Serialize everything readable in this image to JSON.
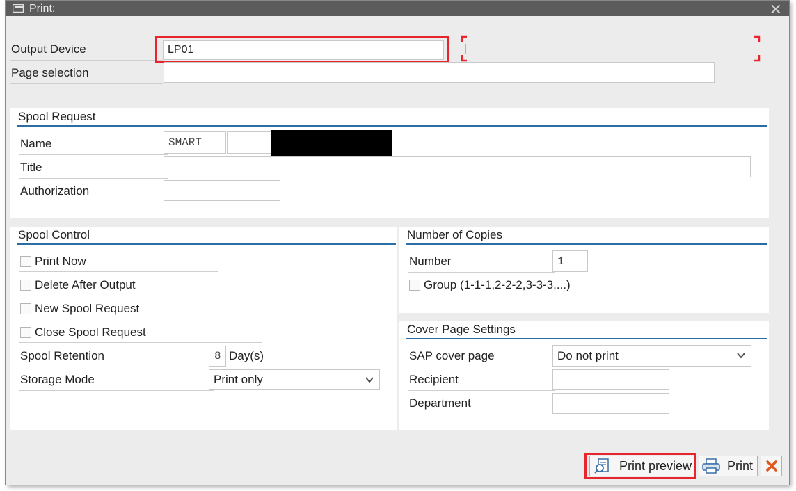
{
  "dialog": {
    "title": "Print:"
  },
  "output": {
    "device_label": "Output Device",
    "device_value": "LP01",
    "page_selection_label": "Page selection",
    "page_selection_value": ""
  },
  "spool_request": {
    "title": "Spool Request",
    "name_label": "Name",
    "name_value": "SMART",
    "name_value2": "",
    "title_label": "Title",
    "title_value": "",
    "authorization_label": "Authorization",
    "authorization_value": ""
  },
  "spool_control": {
    "title": "Spool Control",
    "print_now": "Print Now",
    "delete_after_output": "Delete After Output",
    "new_spool_request": "New Spool Request",
    "close_spool_request": "Close Spool Request",
    "retention_label": "Spool Retention",
    "retention_value": "8",
    "retention_unit": "Day(s)",
    "storage_mode_label": "Storage Mode",
    "storage_mode_value": "Print only"
  },
  "copies": {
    "title": "Number of Copies",
    "number_label": "Number",
    "number_value": "1",
    "group_label": "Group (1-1-1,2-2-2,3-3-3,...)"
  },
  "cover_page": {
    "title": "Cover Page Settings",
    "sap_cover_label": "SAP cover page",
    "sap_cover_value": "Do not print",
    "recipient_label": "Recipient",
    "recipient_value": "",
    "department_label": "Department",
    "department_value": ""
  },
  "footer": {
    "print_preview": "Print preview",
    "print": "Print"
  },
  "colors": {
    "highlight": "#e8242c",
    "accent": "#2c6ea3"
  },
  "icons": [
    "dialog-icon",
    "close-icon",
    "print-preview-icon",
    "printer-icon",
    "cancel-icon",
    "dropdown-chevron-icon"
  ]
}
